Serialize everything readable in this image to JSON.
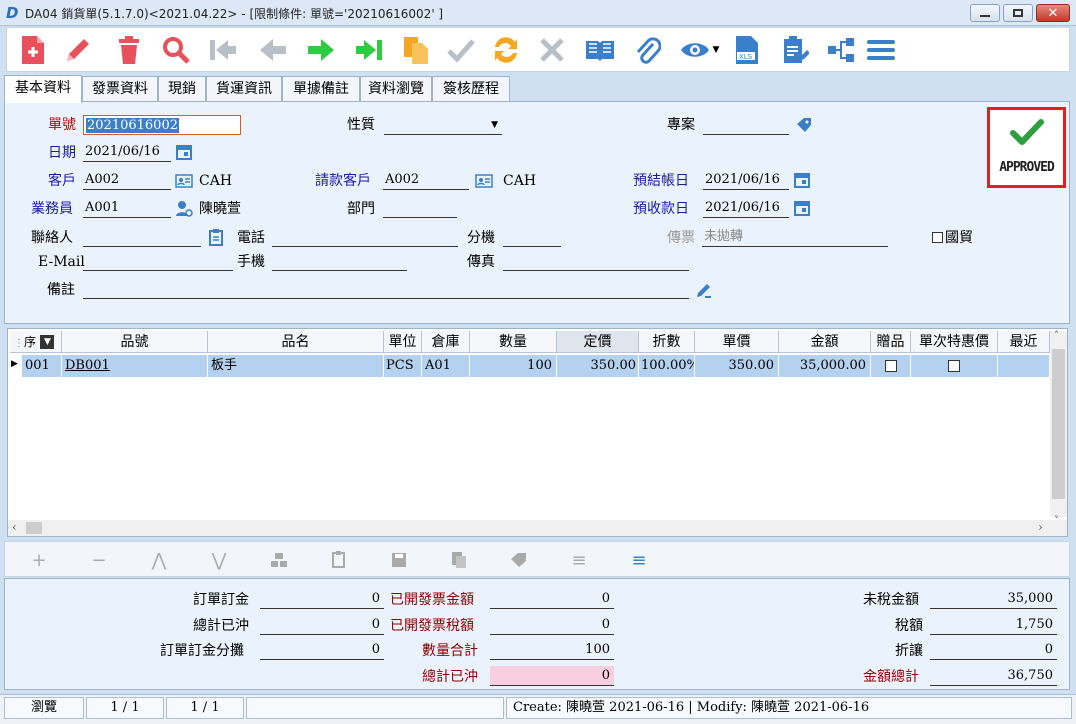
{
  "window": {
    "title": "DA04 銷貨單(5.1.7.0)<2021.04.22> - [限制條件: 單號='20210616002' ]"
  },
  "tabs": [
    "基本資料",
    "發票資料",
    "現銷",
    "貨運資訊",
    "單據備註",
    "資料瀏覽",
    "簽核歷程"
  ],
  "header": {
    "order_no_label": "單號",
    "order_no": "20210616002",
    "nature_label": "性質",
    "nature_value": "",
    "project_label": "專案",
    "project_value": "",
    "date_label": "日期",
    "date": "2021/06/16",
    "customer_label": "客戶",
    "customer_code": "A002",
    "customer_name": "CAH",
    "billing_customer_label": "請款客戶",
    "billing_customer_code": "A002",
    "billing_customer_name": "CAH",
    "expected_close_label": "預結帳日",
    "expected_close_date": "2021/06/16",
    "salesman_label": "業務員",
    "salesman_code": "A001",
    "salesman_name": "陳曉萱",
    "department_label": "部門",
    "department_value": "",
    "expected_collect_label": "預收款日",
    "expected_collect_date": "2021/06/16",
    "contact_label": "聯絡人",
    "contact_value": "",
    "phone_label": "電話",
    "phone_value": "",
    "ext_label": "分機",
    "ext_value": "",
    "fax_ticket_label": "傳票",
    "fax_ticket_value": "未拋轉",
    "international_label": "國貿",
    "email_label": "E-Mail",
    "email_value": "",
    "mobile_label": "手機",
    "mobile_value": "",
    "fax_label": "傳真",
    "fax_value": "",
    "note_label": "備註",
    "note_value": "",
    "approved_stamp": "APPROVED"
  },
  "grid": {
    "columns": [
      "序",
      "品號",
      "品名",
      "單位",
      "倉庫",
      "數量",
      "定價",
      "折數",
      "單價",
      "金額",
      "贈品",
      "單次特惠價",
      "最近"
    ],
    "rows": [
      {
        "seq": "001",
        "item_no": "DB001",
        "item_name": "板手",
        "unit": "PCS",
        "warehouse": "A01",
        "qty": "100",
        "list_price": "350.00",
        "discount": "100.00%",
        "unit_price": "350.00",
        "amount": "35,000.00"
      }
    ]
  },
  "footer": {
    "order_deposit_label": "訂單訂金",
    "order_deposit": "0",
    "total_offset_label": "總計已沖",
    "total_offset": "0",
    "deposit_alloc_label": "訂單訂金分攤",
    "deposit_alloc": "0",
    "invoiced_amount_label": "已開發票金額",
    "invoiced_amount": "0",
    "invoiced_tax_label": "已開發票稅額",
    "invoiced_tax": "0",
    "qty_total_label": "數量合計",
    "qty_total": "100",
    "total_offset2_label": "總計已沖",
    "total_offset2": "0",
    "pretax_label": "未稅金額",
    "pretax": "35,000",
    "tax_label": "稅額",
    "tax": "1,750",
    "discount_label": "折讓",
    "discount": "0",
    "grand_total_label": "金額總計",
    "grand_total": "36,750"
  },
  "status": {
    "mode": "瀏覽",
    "page1": "1 / 1",
    "page2": "1 / 1",
    "audit": "Create: 陳曉萱  2021-06-16 | Modify: 陳曉萱  2021-06-16"
  },
  "colors": {
    "selected_row": "#b5d1f0",
    "required_label": "#c00000",
    "link_label": "#1a1aa8",
    "approved_border": "#dd2222",
    "approved_check": "#2e9e3e"
  }
}
